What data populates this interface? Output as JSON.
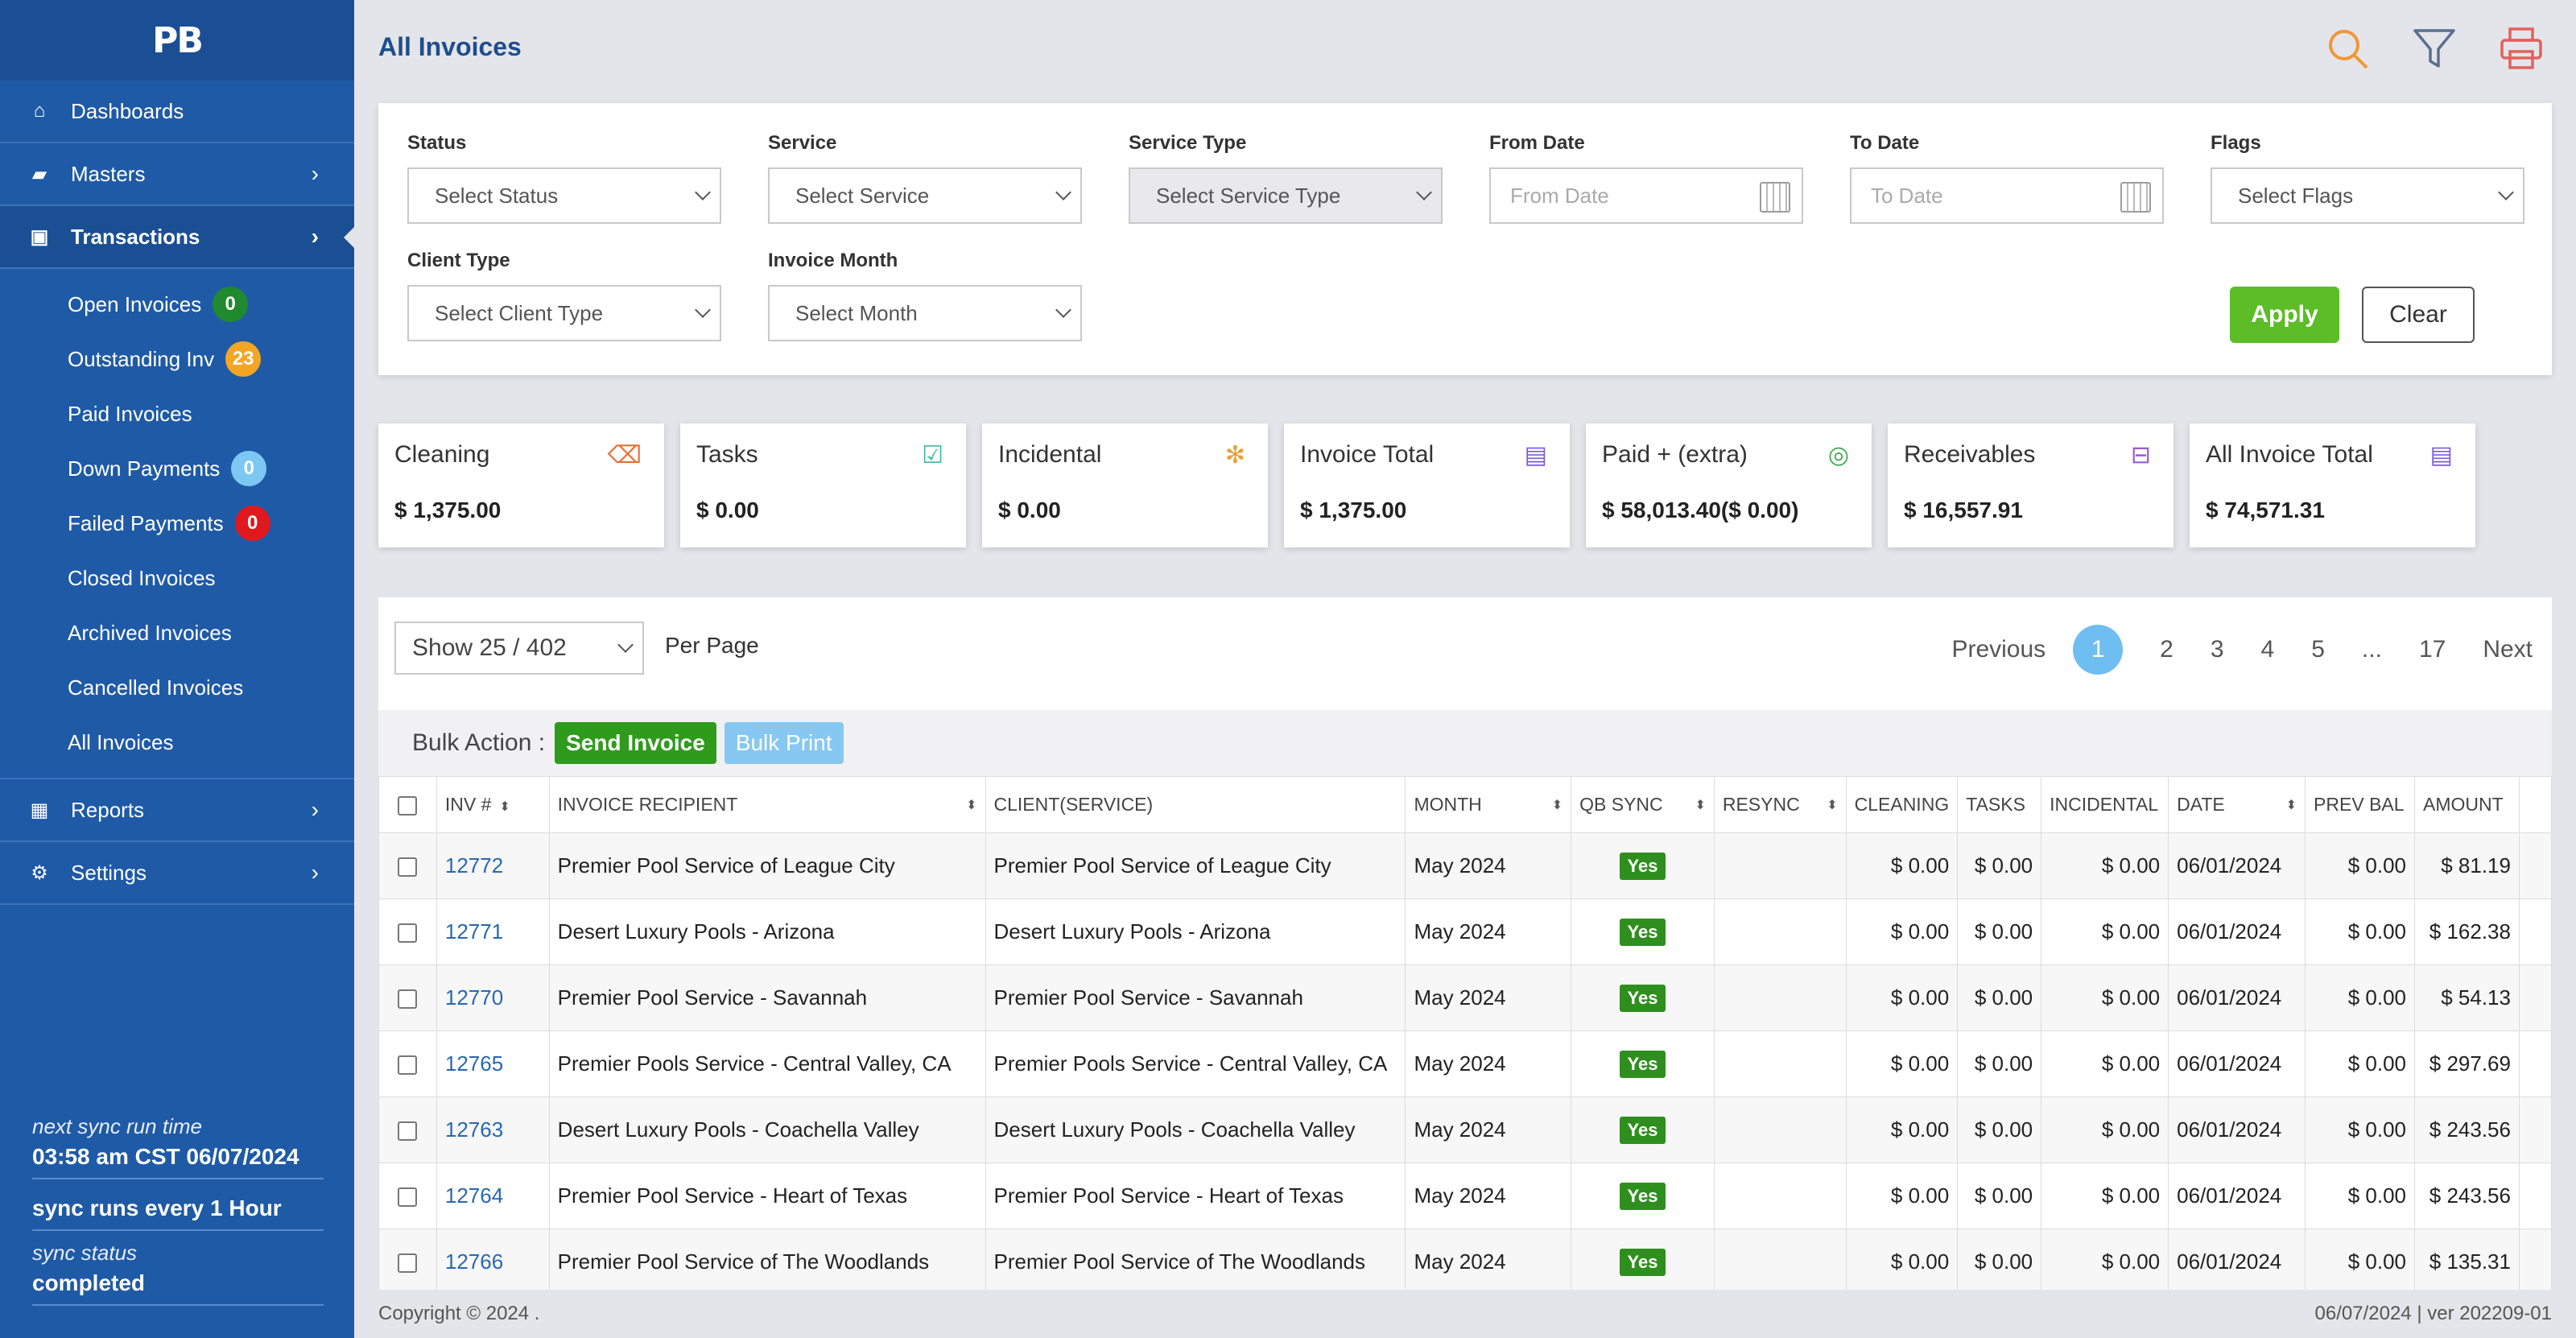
{
  "sidebar": {
    "logo": "PB",
    "nav": {
      "dashboards": "Dashboards",
      "masters": "Masters",
      "transactions": "Transactions",
      "reports": "Reports",
      "settings": "Settings"
    },
    "sub": [
      {
        "label": "Open Invoices",
        "badge": "0",
        "badge_color": "#1f8a2e"
      },
      {
        "label": "Outstanding Inv",
        "badge": "23",
        "badge_color": "#f2a623"
      },
      {
        "label": "Paid Invoices",
        "badge": null
      },
      {
        "label": "Down Payments",
        "badge": "0",
        "badge_color": "#7cc8f2"
      },
      {
        "label": "Failed Payments",
        "badge": "0",
        "badge_color": "#e0191e"
      },
      {
        "label": "Closed Invoices",
        "badge": null
      },
      {
        "label": "Archived Invoices",
        "badge": null
      },
      {
        "label": "Cancelled Invoices",
        "badge": null
      },
      {
        "label": "All Invoices",
        "badge": null
      }
    ],
    "sync": {
      "next_label": "next sync run time",
      "next_value": "03:58 am CST 06/07/2024",
      "every": "sync runs every 1 Hour",
      "status_label": "sync status",
      "status_value": "completed"
    }
  },
  "page": {
    "title": "All Invoices",
    "icons": [
      "search-icon",
      "filter-icon",
      "print-icon"
    ]
  },
  "filters": {
    "status": {
      "label": "Status",
      "value": "Select Status"
    },
    "service": {
      "label": "Service",
      "value": "Select Service"
    },
    "service_type": {
      "label": "Service Type",
      "value": "Select Service Type"
    },
    "from_date": {
      "label": "From Date",
      "placeholder": "From Date"
    },
    "to_date": {
      "label": "To Date",
      "placeholder": "To Date"
    },
    "flags": {
      "label": "Flags",
      "value": "Select Flags"
    },
    "client_type": {
      "label": "Client Type",
      "value": "Select Client Type"
    },
    "invoice_month": {
      "label": "Invoice Month",
      "value": "Select Month"
    },
    "apply": "Apply",
    "clear": "Clear"
  },
  "stats": [
    {
      "label": "Cleaning",
      "value": "$ 1,375.00",
      "icon": "broom-icon",
      "color": "#e8703a"
    },
    {
      "label": "Tasks",
      "value": "$ 0.00",
      "icon": "task-icon",
      "color": "#3bb9a6"
    },
    {
      "label": "Incidental",
      "value": "$ 0.00",
      "icon": "incidental-icon",
      "color": "#e9a03c"
    },
    {
      "label": "Invoice Total",
      "value": "$ 1,375.00",
      "icon": "invoice-icon",
      "color": "#7a5bd6"
    },
    {
      "label": "Paid + (extra)",
      "value": "$ 58,013.40($ 0.00)",
      "icon": "paid-icon",
      "color": "#3daa4c"
    },
    {
      "label": "Receivables",
      "value": "$ 16,557.91",
      "icon": "receivables-icon",
      "color": "#9a5bd6"
    },
    {
      "label": "All Invoice Total",
      "value": "$ 74,571.31",
      "icon": "invoice-icon",
      "color": "#7a5bd6"
    }
  ],
  "table_controls": {
    "per_page_value": "Show 25 / 402",
    "per_page_label": "Per Page",
    "pager": [
      "Previous",
      "1",
      "2",
      "3",
      "4",
      "5",
      "...",
      "17",
      "Next"
    ],
    "bulk_label": "Bulk Action :",
    "send_invoice": "Send Invoice",
    "bulk_print": "Bulk Print"
  },
  "columns": [
    "INV #",
    "INVOICE RECIPIENT",
    "CLIENT(SERVICE)",
    "MONTH",
    "QB SYNC",
    "RESYNC",
    "CLEANING",
    "TASKS",
    "INCIDENTAL",
    "DATE",
    "PREV BAL",
    "AMOUNT"
  ],
  "rows": [
    {
      "inv": "12772",
      "recipient": "Premier Pool Service of League City",
      "client": "Premier Pool Service of League City",
      "month": "May 2024",
      "qb": "Yes",
      "cleaning": "$ 0.00",
      "tasks": "$ 0.00",
      "incidental": "$ 0.00",
      "date": "06/01/2024",
      "prev": "$ 0.00",
      "amount": "$ 81.19"
    },
    {
      "inv": "12771",
      "recipient": "Desert Luxury Pools - Arizona",
      "client": "Desert Luxury Pools - Arizona",
      "month": "May 2024",
      "qb": "Yes",
      "cleaning": "$ 0.00",
      "tasks": "$ 0.00",
      "incidental": "$ 0.00",
      "date": "06/01/2024",
      "prev": "$ 0.00",
      "amount": "$ 162.38"
    },
    {
      "inv": "12770",
      "recipient": "Premier Pool Service - Savannah",
      "client": "Premier Pool Service - Savannah",
      "month": "May 2024",
      "qb": "Yes",
      "cleaning": "$ 0.00",
      "tasks": "$ 0.00",
      "incidental": "$ 0.00",
      "date": "06/01/2024",
      "prev": "$ 0.00",
      "amount": "$ 54.13"
    },
    {
      "inv": "12765",
      "recipient": "Premier Pools Service - Central Valley, CA",
      "client": "Premier Pools Service - Central Valley, CA",
      "month": "May 2024",
      "qb": "Yes",
      "cleaning": "$ 0.00",
      "tasks": "$ 0.00",
      "incidental": "$ 0.00",
      "date": "06/01/2024",
      "prev": "$ 0.00",
      "amount": "$ 297.69"
    },
    {
      "inv": "12763",
      "recipient": "Desert Luxury Pools - Coachella Valley",
      "client": "Desert Luxury Pools - Coachella Valley",
      "month": "May 2024",
      "qb": "Yes",
      "cleaning": "$ 0.00",
      "tasks": "$ 0.00",
      "incidental": "$ 0.00",
      "date": "06/01/2024",
      "prev": "$ 0.00",
      "amount": "$ 243.56"
    },
    {
      "inv": "12764",
      "recipient": "Premier Pool Service - Heart of Texas",
      "client": "Premier Pool Service - Heart of Texas",
      "month": "May 2024",
      "qb": "Yes",
      "cleaning": "$ 0.00",
      "tasks": "$ 0.00",
      "incidental": "$ 0.00",
      "date": "06/01/2024",
      "prev": "$ 0.00",
      "amount": "$ 243.56"
    },
    {
      "inv": "12766",
      "recipient": "Premier Pool Service of The Woodlands",
      "client": "Premier Pool Service of The Woodlands",
      "month": "May 2024",
      "qb": "Yes",
      "cleaning": "$ 0.00",
      "tasks": "$ 0.00",
      "incidental": "$ 0.00",
      "date": "06/01/2024",
      "prev": "$ 0.00",
      "amount": "$ 135.31"
    }
  ],
  "footer": {
    "copyright": "Copyright © 2024 .",
    "version": "06/07/2024 | ver 202209-01"
  }
}
